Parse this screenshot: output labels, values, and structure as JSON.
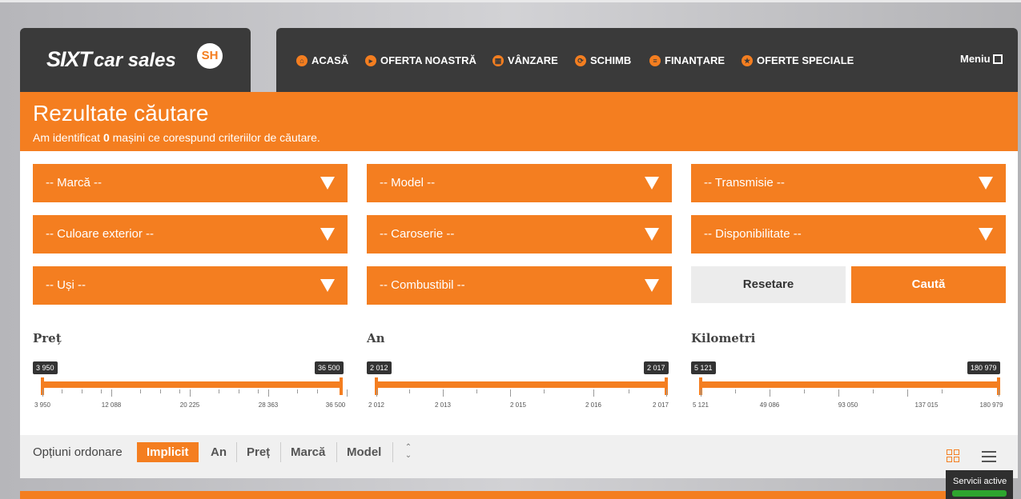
{
  "brand": {
    "logo_text": "SIXT",
    "logo_suffix": "car sales",
    "logo_badge": "SH"
  },
  "nav": {
    "items": [
      {
        "icon": "home-icon",
        "label": "ACASĂ"
      },
      {
        "icon": "car-icon",
        "label": "OFERTA NOASTRĂ"
      },
      {
        "icon": "sale-icon",
        "label": "VÂNZARE"
      },
      {
        "icon": "exchange-icon",
        "label": "SCHIMB"
      },
      {
        "icon": "finance-icon",
        "label": "FINANȚARE"
      },
      {
        "icon": "star-icon",
        "label": "OFERTE SPECIALE"
      }
    ],
    "menu_label": "Meniu"
  },
  "header": {
    "title": "Rezultate căutare",
    "summary_prefix": "Am identificat ",
    "count": "0",
    "summary_suffix": " mașini ce corespund criteriilor de căutare."
  },
  "filters": {
    "brand": "-- Marcă --",
    "model": "-- Model --",
    "transmission": "-- Transmisie --",
    "color": "-- Culoare exterior --",
    "body": "-- Caroserie --",
    "availability": "-- Disponibilitate --",
    "doors": "-- Uși --",
    "fuel": "-- Combustibil --",
    "reset": "Resetare",
    "search": "Caută"
  },
  "sliders": {
    "price": {
      "label": "Preț",
      "min": "3 950",
      "max": "36 500",
      "ticks": [
        "3 950",
        "12 088",
        "20 225",
        "28 363",
        "36 500"
      ]
    },
    "year": {
      "label": "An",
      "min": "2 012",
      "max": "2 017",
      "ticks": [
        "2 012",
        "2 013",
        "2 015",
        "2 016",
        "2 017"
      ]
    },
    "km": {
      "label": "Kilometri",
      "min": "5 121",
      "max": "180 979",
      "ticks": [
        "5 121",
        "49 086",
        "93 050",
        "137 015",
        "180 979"
      ]
    }
  },
  "sort": {
    "label": "Opțiuni ordonare",
    "options": [
      "Implicit",
      "An",
      "Preț",
      "Marcă",
      "Model"
    ],
    "active": "Implicit"
  },
  "services": {
    "label": "Servicii active"
  },
  "colors": {
    "accent": "#f47e20",
    "dark": "#3a3a3a",
    "light": "#f0f0f0"
  }
}
